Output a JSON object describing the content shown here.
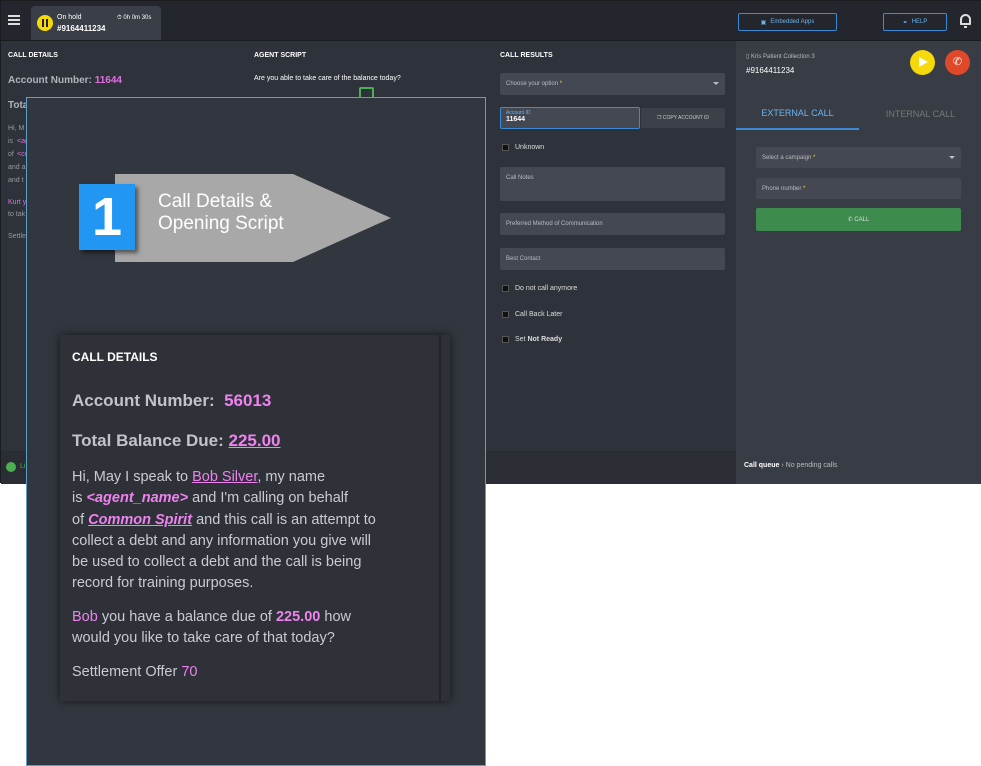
{
  "topbar": {
    "hold_status": "On hold",
    "hold_number": "#9164411234",
    "timer": "0h 0m 30s",
    "embedded_apps": "Embedded Apps",
    "help": "HELP"
  },
  "columns": {
    "call_details": "CALL DETAILS",
    "agent_script": "AGENT SCRIPT",
    "call_results": "CALL RESULTS"
  },
  "background_details": {
    "account_label": "Account Number:",
    "account_number": "11644",
    "total_fragment": "Tota",
    "frag_hi": "Hi, M",
    "frag_is": "is",
    "frag_age": "<age",
    "frag_of": "of",
    "frag_co": "<co",
    "frag_and": "and a",
    "frag_and2": "and t",
    "frag_kurt": "Kurt y",
    "frag_totak": "to tak",
    "frag_settl": "Settle",
    "online": "Li"
  },
  "agent_script": {
    "question": "Are you able to take care of the balance today?"
  },
  "call_results": {
    "choose_option": "Choose your option",
    "account_id_label": "Account ID",
    "account_id_value": "11644",
    "copy_account_id": "COPY ACCOUNT ID",
    "unknown": "Unknown",
    "call_notes": "Call Notes",
    "preferred_method": "Preferred Method of Communication",
    "best_contact": "Best Contact",
    "do_not_call": "Do not call anymore",
    "call_back_later": "Call Back Later",
    "set_label": "Set",
    "not_ready": "Not Ready"
  },
  "right_panel": {
    "patient_name": "Kris Patient Collection 3",
    "patient_number": "#9164411234",
    "tab_external": "EXTERNAL CALL",
    "tab_internal": "INTERNAL CALL",
    "select_campaign": "Select a campaign",
    "phone_number": "Phone number",
    "call_button": "CALL"
  },
  "footer": {
    "call_queue": "Call queue",
    "no_pending": "No pending calls"
  },
  "callout": {
    "number": "1",
    "line1": "Call Details &",
    "line2": "Opening Script"
  },
  "card": {
    "header": "CALL DETAILS",
    "account_label": "Account Number:",
    "account_number": "56013",
    "balance_label": "Total Balance Due:",
    "balance_value": "225.00",
    "p1_a": "Hi, May I speak to",
    "p1_name": "Bob Silver",
    "p1_b": ", my name",
    "p1_is": "is",
    "p1_agent": "<agent_name>",
    "p1_c": "and I'm calling on behalf",
    "p1_of": "of",
    "p1_company": "Common Spirit",
    "p1_d": "and this call is an attempt to",
    "p1_e": "collect a debt and any information you give will",
    "p1_f": "be used to collect a debt and the call is being",
    "p1_g": "record for training purposes.",
    "p2_name": "Bob",
    "p2_a": "you have a balance due of",
    "p2_amount": "225.00",
    "p2_b": "how",
    "p2_c": "would you like to take care of that today?",
    "settlement_label": "Settlement Offer",
    "settlement_value": "70"
  },
  "colors": {
    "accent_blue": "#2196f3",
    "pink": "#ee82ee",
    "yellow": "#f5d90a",
    "green": "#3e8b4e",
    "red": "#e0482a"
  }
}
